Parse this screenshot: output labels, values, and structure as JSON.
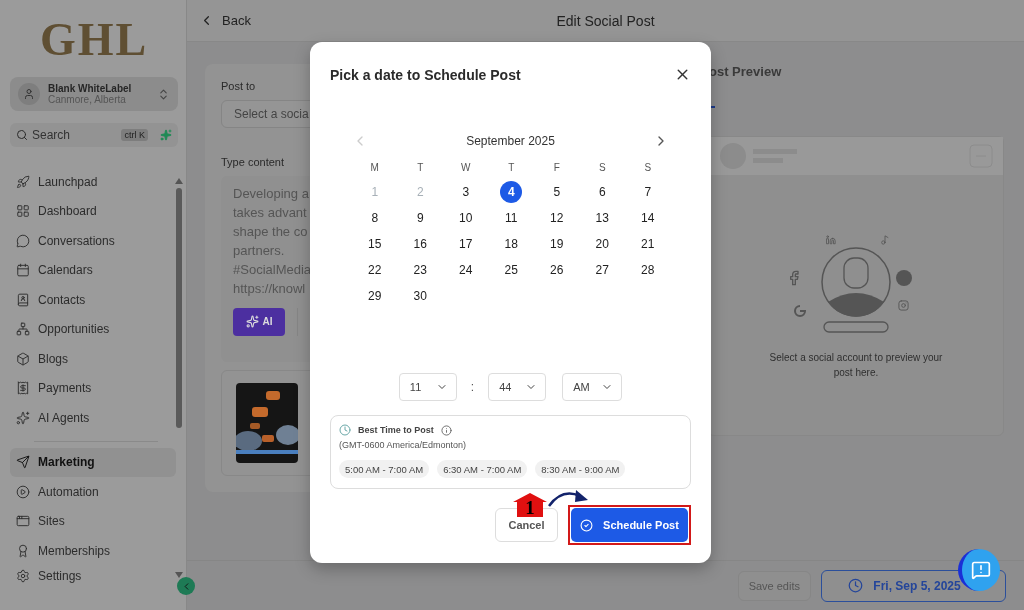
{
  "sidebar": {
    "logo": "GHL",
    "account": {
      "name": "Blank WhiteLabel",
      "location": "Canmore, Alberta"
    },
    "search": {
      "placeholder": "Search",
      "shortcut": "ctrl K"
    },
    "items": [
      {
        "label": "Launchpad",
        "selected": false
      },
      {
        "label": "Dashboard",
        "selected": false
      },
      {
        "label": "Conversations",
        "selected": false
      },
      {
        "label": "Calendars",
        "selected": false
      },
      {
        "label": "Contacts",
        "selected": false
      },
      {
        "label": "Opportunities",
        "selected": false
      },
      {
        "label": "Blogs",
        "selected": false
      },
      {
        "label": "Payments",
        "selected": false
      },
      {
        "label": "AI Agents",
        "selected": false
      }
    ],
    "marketing_items": [
      {
        "label": "Marketing",
        "selected": true
      },
      {
        "label": "Automation",
        "selected": false
      },
      {
        "label": "Sites",
        "selected": false
      },
      {
        "label": "Memberships",
        "selected": false
      }
    ],
    "settings": "Settings"
  },
  "header": {
    "back": "Back",
    "title": "Edit Social Post"
  },
  "editor": {
    "post_to_label": "Post to",
    "select_placeholder": "Select a socia",
    "content_label": "Type content",
    "content_lines": [
      "Developing a",
      "takes advant",
      "shape the co",
      "partners.",
      "#SocialMedia",
      "https://knowl"
    ],
    "ai_button": "AI"
  },
  "preview": {
    "title": "ost Preview",
    "message": "Select a social account to preview your post here."
  },
  "footer": {
    "save": "Save edits",
    "date": "Fri, Sep 5, 2025"
  },
  "modal": {
    "title": "Pick a date to Schedule Post",
    "month": "September 2025",
    "weekdays": [
      "M",
      "T",
      "W",
      "T",
      "F",
      "S",
      "S"
    ],
    "weeks": [
      [
        {
          "day": "1",
          "disabled": true,
          "selected": false
        },
        {
          "day": "2",
          "disabled": true,
          "selected": false
        },
        {
          "day": "3",
          "disabled": false,
          "selected": false
        },
        {
          "day": "4",
          "disabled": false,
          "selected": true
        },
        {
          "day": "5",
          "disabled": false,
          "selected": false
        },
        {
          "day": "6",
          "disabled": false,
          "selected": false
        },
        {
          "day": "7",
          "disabled": false,
          "selected": false
        }
      ],
      [
        {
          "day": "8",
          "disabled": false,
          "selected": false
        },
        {
          "day": "9",
          "disabled": false,
          "selected": false
        },
        {
          "day": "10",
          "disabled": false,
          "selected": false
        },
        {
          "day": "11",
          "disabled": false,
          "selected": false
        },
        {
          "day": "12",
          "disabled": false,
          "selected": false
        },
        {
          "day": "13",
          "disabled": false,
          "selected": false
        },
        {
          "day": "14",
          "disabled": false,
          "selected": false
        }
      ],
      [
        {
          "day": "15",
          "disabled": false,
          "selected": false
        },
        {
          "day": "16",
          "disabled": false,
          "selected": false
        },
        {
          "day": "17",
          "disabled": false,
          "selected": false
        },
        {
          "day": "18",
          "disabled": false,
          "selected": false
        },
        {
          "day": "19",
          "disabled": false,
          "selected": false
        },
        {
          "day": "20",
          "disabled": false,
          "selected": false
        },
        {
          "day": "21",
          "disabled": false,
          "selected": false
        }
      ],
      [
        {
          "day": "22",
          "disabled": false,
          "selected": false
        },
        {
          "day": "23",
          "disabled": false,
          "selected": false
        },
        {
          "day": "24",
          "disabled": false,
          "selected": false
        },
        {
          "day": "25",
          "disabled": false,
          "selected": false
        },
        {
          "day": "26",
          "disabled": false,
          "selected": false
        },
        {
          "day": "27",
          "disabled": false,
          "selected": false
        },
        {
          "day": "28",
          "disabled": false,
          "selected": false
        }
      ],
      [
        {
          "day": "29",
          "disabled": false,
          "selected": false
        },
        {
          "day": "30",
          "disabled": false,
          "selected": false
        }
      ]
    ],
    "time": {
      "hour": "11",
      "separator": ":",
      "minute": "44",
      "period": "AM"
    },
    "best_time": {
      "title": "Best Time to Post",
      "timezone": "(GMT-0600 America/Edmonton)",
      "slots": [
        "5:00 AM - 7:00 AM",
        "6:30 AM - 7:00 AM",
        "8:30 AM - 9:00 AM"
      ]
    },
    "cancel": "Cancel",
    "schedule": "Schedule Post"
  },
  "annotation": {
    "step": "1"
  }
}
